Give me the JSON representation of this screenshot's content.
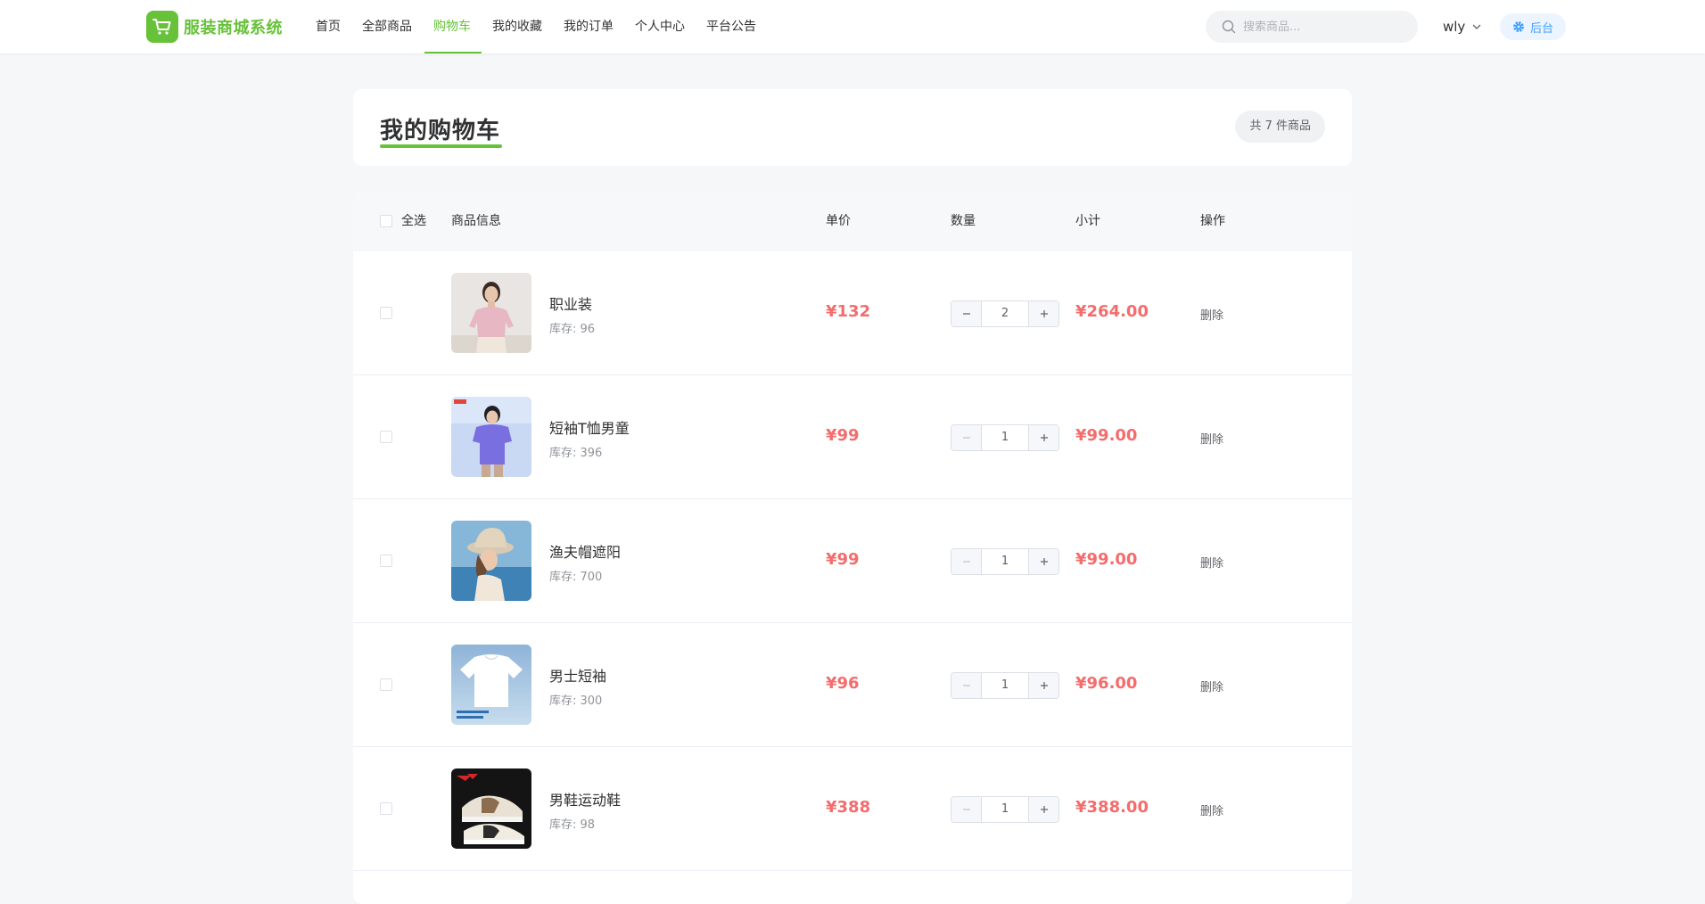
{
  "app": {
    "brand": "服装商城系统"
  },
  "nav": {
    "items": [
      {
        "label": "首页"
      },
      {
        "label": "全部商品"
      },
      {
        "label": "购物车"
      },
      {
        "label": "我的收藏"
      },
      {
        "label": "我的订单"
      },
      {
        "label": "个人中心"
      },
      {
        "label": "平台公告"
      }
    ],
    "active": "购物车"
  },
  "search": {
    "placeholder": "搜索商品...",
    "value": ""
  },
  "user": {
    "name": "wly"
  },
  "admin": {
    "label": "后台"
  },
  "cart": {
    "title": "我的购物车",
    "count_badge": "共 7 件商品",
    "header": {
      "select_all": "全选",
      "product_info": "商品信息",
      "unit_price": "单价",
      "quantity": "数量",
      "subtotal": "小计",
      "actions": "操作"
    },
    "items": [
      {
        "name": "职业装",
        "stock": "库存: 96",
        "price": "¥132",
        "qty": "2",
        "subtotal": "¥264.00",
        "delete": "删除",
        "image": "woman-in-pink-polo",
        "minus_disabled": false
      },
      {
        "name": "短袖T恤男童",
        "stock": "库存: 396",
        "price": "¥99",
        "qty": "1",
        "subtotal": "¥99.00",
        "delete": "删除",
        "image": "boy-in-purple-tshirt",
        "minus_disabled": true
      },
      {
        "name": "渔夫帽遮阳",
        "stock": "库存: 700",
        "price": "¥99",
        "qty": "1",
        "subtotal": "¥99.00",
        "delete": "删除",
        "image": "woman-in-bucket-hat",
        "minus_disabled": true
      },
      {
        "name": "男士短袖",
        "stock": "库存: 300",
        "price": "¥96",
        "qty": "1",
        "subtotal": "¥96.00",
        "delete": "删除",
        "image": "white-tshirt",
        "minus_disabled": true
      },
      {
        "name": "男鞋运动鞋",
        "stock": "库存: 98",
        "price": "¥388",
        "qty": "1",
        "subtotal": "¥388.00",
        "delete": "删除",
        "image": "sneakers",
        "minus_disabled": true
      }
    ]
  },
  "colors": {
    "brand_green": "#67c23a",
    "price_red": "#f56c6c",
    "admin_blue": "#409eff",
    "page_bg": "#f5f7f9"
  }
}
